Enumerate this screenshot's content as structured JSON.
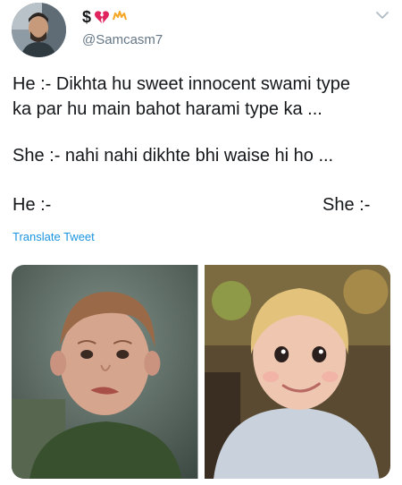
{
  "author": {
    "display_name": "$",
    "handle": "@Samcasm7"
  },
  "tweet": {
    "line1": "He :- Dikhta hu sweet innocent swami type",
    "line2": "ka par hu main bahot harami type ka ...",
    "line3": "She :- nahi nahi dikhte bhi waise hi ho ...",
    "he_label": "He :-",
    "she_label": "She :-"
  },
  "translate_label": "Translate Tweet",
  "colors": {
    "link": "#1b95e0",
    "secondary_text": "#657786",
    "broken_heart": "#e0245e",
    "crown": "#f5a623"
  },
  "icons": [
    "broken-heart-icon",
    "crown-icon",
    "chevron-down-icon"
  ]
}
